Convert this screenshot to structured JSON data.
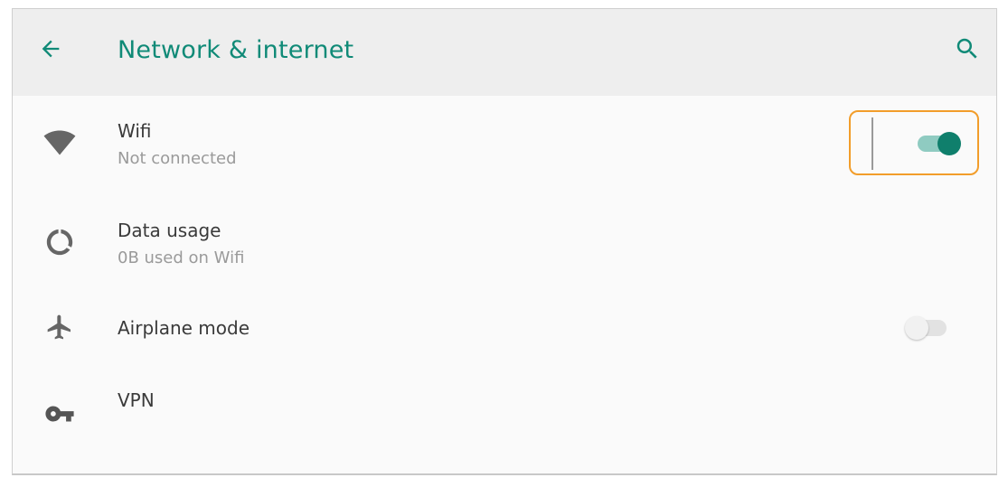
{
  "header": {
    "title": "Network & internet",
    "back_icon": "arrow-back-icon",
    "search_icon": "search-icon"
  },
  "colors": {
    "accent": "#108a77",
    "focus_outline": "#f29d2a"
  },
  "items": [
    {
      "icon": "wifi-icon",
      "title": "Wifi",
      "subtitle": "Not connected",
      "toggle": "on"
    },
    {
      "icon": "data-usage-icon",
      "title": "Data usage",
      "subtitle": "0B used on Wifi"
    },
    {
      "icon": "airplane-icon",
      "title": "Airplane mode",
      "toggle": "off"
    },
    {
      "icon": "vpn-key-icon",
      "title": "VPN"
    }
  ]
}
